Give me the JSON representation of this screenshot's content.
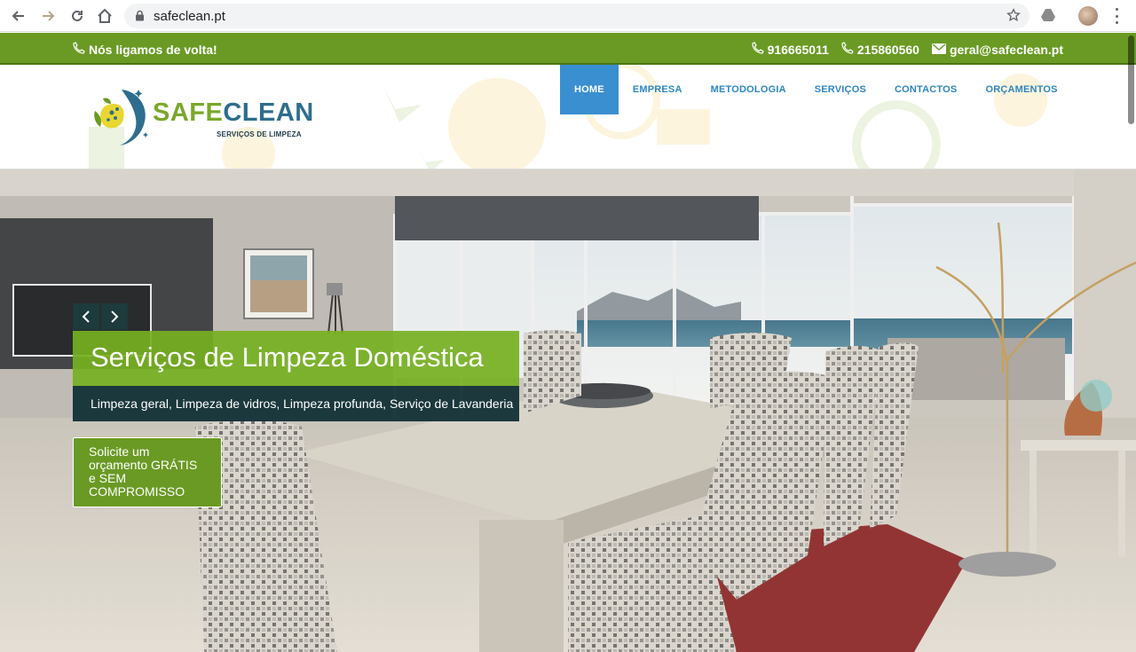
{
  "browser": {
    "url": "safeclean.pt",
    "icons": [
      "back-icon",
      "forward-icon",
      "reload-icon",
      "home-icon",
      "lock-icon",
      "star-icon",
      "drive-extension-icon",
      "profile-avatar",
      "menu-icon"
    ]
  },
  "topbar": {
    "callback_label": "Nós ligamos de volta!",
    "phone1": "916665011",
    "phone2": "215860560",
    "email": "geral@safeclean.pt",
    "color": "#6a9a24"
  },
  "logo": {
    "brand_part1": "SAFE",
    "brand_part2": "CLEAN",
    "tagline": "SERVIÇOS DE LIMPEZA"
  },
  "menu": {
    "items": [
      {
        "label": "HOME",
        "active": true
      },
      {
        "label": "EMPRESA",
        "active": false
      },
      {
        "label": "METODOLOGIA",
        "active": false
      },
      {
        "label": "SERVIÇOS",
        "active": false
      },
      {
        "label": "CONTACTOS",
        "active": false
      },
      {
        "label": "ORÇAMENTOS",
        "active": false
      }
    ],
    "active_color": "#3a8fd0",
    "link_color": "#2e86c1"
  },
  "hero": {
    "title": "Serviços de Limpeza Doméstica",
    "subtitle": "Limpeza geral, Limpeza de vidros, Limpeza profunda, Serviço de Lavanderia",
    "cta_label": "Solicite um orçamento GRÁTIS e SEM COMPROMISSO",
    "prev_icon": "chevron-left-icon",
    "next_icon": "chevron-right-icon",
    "title_bg": "#76b022",
    "subtitle_bg": "#123036"
  }
}
